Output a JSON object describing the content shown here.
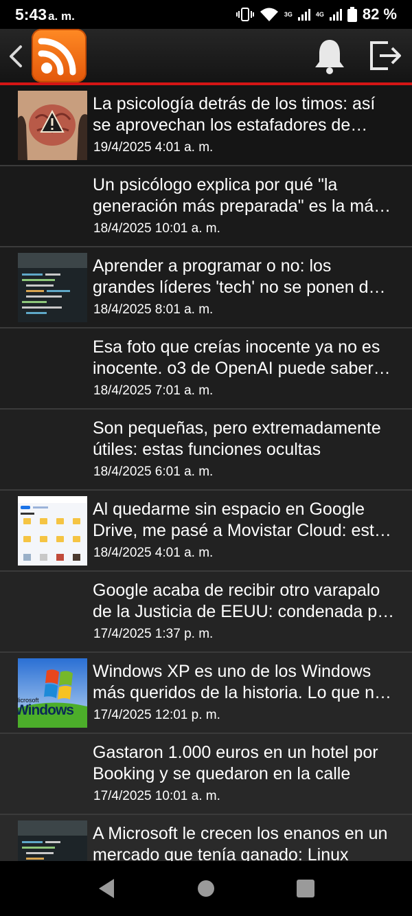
{
  "status_bar": {
    "time": "5:43",
    "ampm": "a. m.",
    "network1": "3G",
    "network2": "4G",
    "battery": "82 %"
  },
  "app_bar": {
    "icons": [
      "back-arrow-icon",
      "rss-logo-icon",
      "bell-icon",
      "exit-icon"
    ],
    "accent": "#d41515",
    "logo_color": "#f07118"
  },
  "articles": [
    {
      "title": "La psicología detrás de los timos: así se aprovechan los estafadores de nuestra mente",
      "date": "19/4/2025 4:01 a. m.",
      "thumb": "brain"
    },
    {
      "title": "Un psicólogo explica por qué \"la generación más preparada\" es la más frágil",
      "date": "18/4/2025 10:01 a. m.",
      "thumb": "none"
    },
    {
      "title": "Aprender a programar o no: los grandes líderes 'tech' no se ponen de acuerdo",
      "date": "18/4/2025 8:01 a. m.",
      "thumb": "code"
    },
    {
      "title": "Esa foto que creías inocente ya no es inocente. o3 de OpenAI puede saber dónde se hizo",
      "date": "18/4/2025 7:01 a. m.",
      "thumb": "none"
    },
    {
      "title": "Son pequeñas, pero extremadamente útiles: estas funciones ocultas",
      "date": "18/4/2025 6:01 a. m.",
      "thumb": "none"
    },
    {
      "title": "Al quedarme sin espacio en Google Drive, me pasé a Movistar Cloud: esta es mi experiencia",
      "date": "18/4/2025 4:01 a. m.",
      "thumb": "drive"
    },
    {
      "title": "Google acaba de recibir otro varapalo de la Justicia de EEUU: condenada por monopolio",
      "date": "17/4/2025 1:37 p. m.",
      "thumb": "none"
    },
    {
      "title": "Windows XP es uno de los Windows más queridos de la historia. Lo que no sabías",
      "date": "17/4/2025 12:01 p. m.",
      "thumb": "windows"
    },
    {
      "title": "Gastaron 1.000 euros en un hotel por Booking y se quedaron en la calle",
      "date": "17/4/2025 10:01 a. m.",
      "thumb": "none"
    },
    {
      "title": "A Microsoft le crecen los enanos en un mercado que tenía ganado: Linux",
      "date": "",
      "thumb": "code"
    }
  ],
  "windows_logo_text": "Windows",
  "windows_logo_small": "Microsoft",
  "navigation_bar": {
    "icons": [
      "nav-back-icon",
      "nav-home-icon",
      "nav-recents-icon"
    ]
  }
}
